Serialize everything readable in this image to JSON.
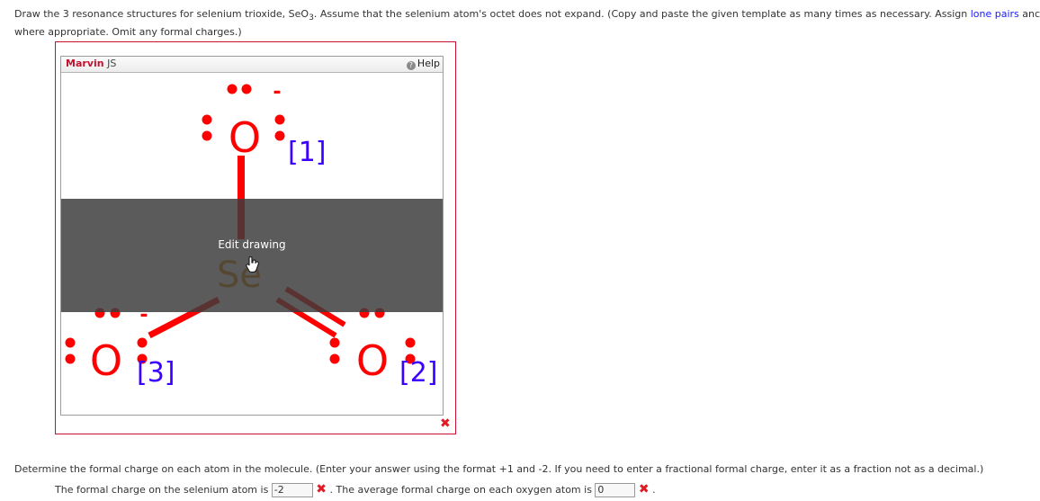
{
  "question": {
    "part1": "Draw the 3 resonance structures for selenium trioxide, SeO",
    "subscript": "3",
    "part2": ". Assume that the selenium atom's octet does not expand. (Copy and paste the given template as many times as necessary. Assign ",
    "link": "lone pairs",
    "part3": " anc",
    "line2": "where appropriate. Omit any formal charges.)"
  },
  "editor": {
    "brand": "Marvin",
    "brand_suffix": " JS",
    "help": "Help",
    "overlay_label": "Edit drawing",
    "atoms": {
      "center": "Se",
      "oxygen": "O",
      "label1": "[1]",
      "label2": "[2]",
      "label3": "[3]",
      "charge": "-"
    }
  },
  "status": {
    "drawing_result": "✖",
    "se_result": "✖",
    "o_result": "✖"
  },
  "question2": "Determine the formal charge on each atom in the molecule. (Enter your answer using the format +1 and -2. If you need to enter a fractional formal charge, enter it as a fraction not as a decimal.)",
  "answers": {
    "se_label": "The formal charge on the selenium atom is",
    "se_value": "-2",
    "o_label": ". The average formal charge on each oxygen atom is",
    "o_value": "0",
    "end": "."
  },
  "colors": {
    "oxygen": "#ff0000",
    "selenium": "#d98a00",
    "label": "#3b00ff",
    "error": "#e01b24"
  }
}
